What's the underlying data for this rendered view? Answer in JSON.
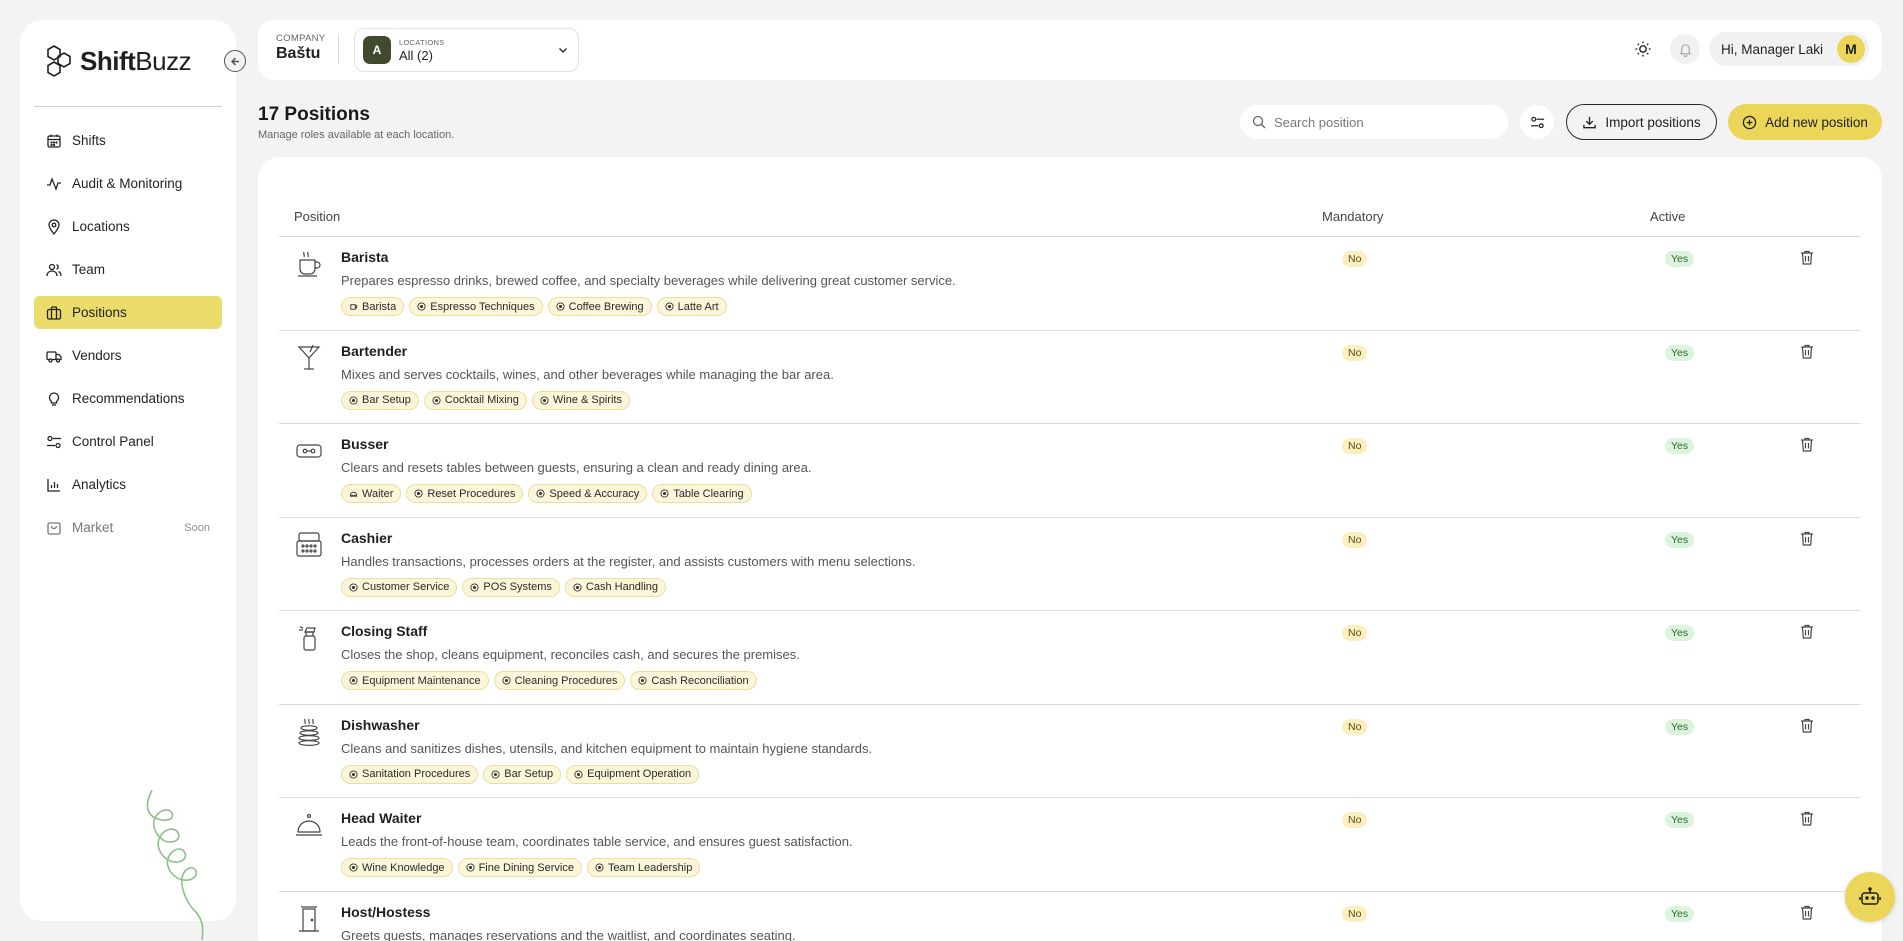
{
  "app": {
    "name": "ShiftBuzz",
    "name_bold": "Shift",
    "name_light": "Buzz"
  },
  "sidebar": {
    "items": [
      {
        "label": "Shifts",
        "icon": "calendar-icon"
      },
      {
        "label": "Audit & Monitoring",
        "icon": "activity-icon"
      },
      {
        "label": "Locations",
        "icon": "map-pin-icon"
      },
      {
        "label": "Team",
        "icon": "users-icon"
      },
      {
        "label": "Positions",
        "icon": "briefcase-icon",
        "active": true
      },
      {
        "label": "Vendors",
        "icon": "truck-icon"
      },
      {
        "label": "Recommendations",
        "icon": "lightbulb-icon"
      },
      {
        "label": "Control Panel",
        "icon": "sliders-icon"
      },
      {
        "label": "Analytics",
        "icon": "bar-chart-icon"
      },
      {
        "label": "Market",
        "icon": "shopping-bag-icon",
        "badge": "Soon",
        "disabled": true
      }
    ]
  },
  "topbar": {
    "company_label": "COMPANY",
    "company_name": "Baštu",
    "locations_label": "LOCATIONS",
    "locations_value": "All (2)",
    "locations_avatar": "A",
    "greeting": "Hi, Manager Laki",
    "user_initial": "M"
  },
  "page": {
    "title": "17 Positions",
    "subtitle": "Manage roles available at each location.",
    "search_placeholder": "Search position",
    "import_label": "Import positions",
    "add_label": "Add new position"
  },
  "table": {
    "headers": {
      "position": "Position",
      "mandatory": "Mandatory",
      "active": "Active"
    },
    "rows": [
      {
        "title": "Barista",
        "icon": "coffee-cup-icon",
        "desc": "Prepares espresso drinks, brewed coffee, and specialty beverages while delivering great customer service.",
        "tags": [
          "Barista",
          "Espresso Techniques",
          "Coffee Brewing",
          "Latte Art"
        ],
        "mandatory": "No",
        "active": "Yes"
      },
      {
        "title": "Bartender",
        "icon": "cocktail-glass-icon",
        "desc": "Mixes and serves cocktails, wines, and other beverages while managing the bar area.",
        "tags": [
          "Bar Setup",
          "Cocktail Mixing",
          "Wine & Spirits"
        ],
        "mandatory": "No",
        "active": "Yes"
      },
      {
        "title": "Busser",
        "icon": "tray-icon",
        "desc": "Clears and resets tables between guests, ensuring a clean and ready dining area.",
        "tags": [
          "Waiter",
          "Reset Procedures",
          "Speed & Accuracy",
          "Table Clearing"
        ],
        "mandatory": "No",
        "active": "Yes"
      },
      {
        "title": "Cashier",
        "icon": "cash-register-icon",
        "desc": "Handles transactions, processes orders at the register, and assists customers with menu selections.",
        "tags": [
          "Customer Service",
          "POS Systems",
          "Cash Handling"
        ],
        "mandatory": "No",
        "active": "Yes"
      },
      {
        "title": "Closing Staff",
        "icon": "spray-bottle-icon",
        "desc": "Closes the shop, cleans equipment, reconciles cash, and secures the premises.",
        "tags": [
          "Equipment Maintenance",
          "Cleaning Procedures",
          "Cash Reconciliation"
        ],
        "mandatory": "No",
        "active": "Yes"
      },
      {
        "title": "Dishwasher",
        "icon": "plate-stack-icon",
        "desc": "Cleans and sanitizes dishes, utensils, and kitchen equipment to maintain hygiene standards.",
        "tags": [
          "Sanitation Procedures",
          "Bar Setup",
          "Equipment Operation"
        ],
        "mandatory": "No",
        "active": "Yes"
      },
      {
        "title": "Head Waiter",
        "icon": "cloche-icon",
        "desc": "Leads the front-of-house team, coordinates table service, and ensures guest satisfaction.",
        "tags": [
          "Wine Knowledge",
          "Fine Dining Service",
          "Team Leadership"
        ],
        "mandatory": "No",
        "active": "Yes"
      },
      {
        "title": "Host/Hostess",
        "icon": "door-icon",
        "desc": "Greets guests, manages reservations and the waitlist, and coordinates seating.",
        "tags": [],
        "mandatory": "No",
        "active": "Yes"
      }
    ]
  }
}
